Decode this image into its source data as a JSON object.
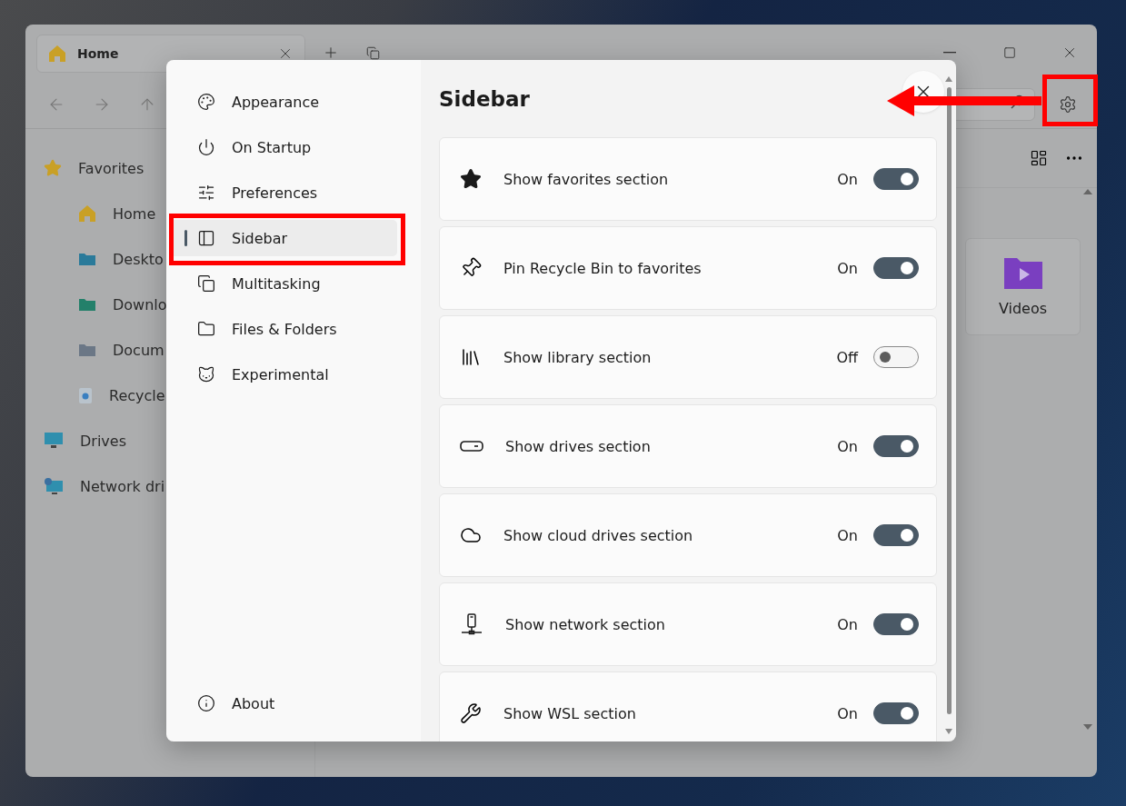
{
  "window": {
    "tab": {
      "title": "Home"
    },
    "sidebar": [
      {
        "label": "Favorites",
        "children": [
          {
            "label": "Home"
          },
          {
            "label": "Deskto"
          },
          {
            "label": "Downlo"
          },
          {
            "label": "Docum"
          },
          {
            "label": "Recycle"
          }
        ]
      },
      {
        "label": "Drives"
      },
      {
        "label": "Network dri"
      }
    ],
    "tiles": [
      {
        "label": "Videos"
      }
    ]
  },
  "settings": {
    "nav": [
      {
        "label": "Appearance",
        "selected": false
      },
      {
        "label": "On Startup",
        "selected": false
      },
      {
        "label": "Preferences",
        "selected": false
      },
      {
        "label": "Sidebar",
        "selected": true
      },
      {
        "label": "Multitasking",
        "selected": false
      },
      {
        "label": "Files & Folders",
        "selected": false
      },
      {
        "label": "Experimental",
        "selected": false
      }
    ],
    "footer": {
      "label": "About"
    },
    "title": "Sidebar",
    "rows": [
      {
        "label": "Show favorites section",
        "state_label": "On",
        "on": true
      },
      {
        "label": "Pin Recycle Bin to favorites",
        "state_label": "On",
        "on": true
      },
      {
        "label": "Show library section",
        "state_label": "Off",
        "on": false
      },
      {
        "label": "Show drives section",
        "state_label": "On",
        "on": true
      },
      {
        "label": "Show cloud drives section",
        "state_label": "On",
        "on": true
      },
      {
        "label": "Show network section",
        "state_label": "On",
        "on": true
      },
      {
        "label": "Show WSL section",
        "state_label": "On",
        "on": true
      }
    ]
  }
}
